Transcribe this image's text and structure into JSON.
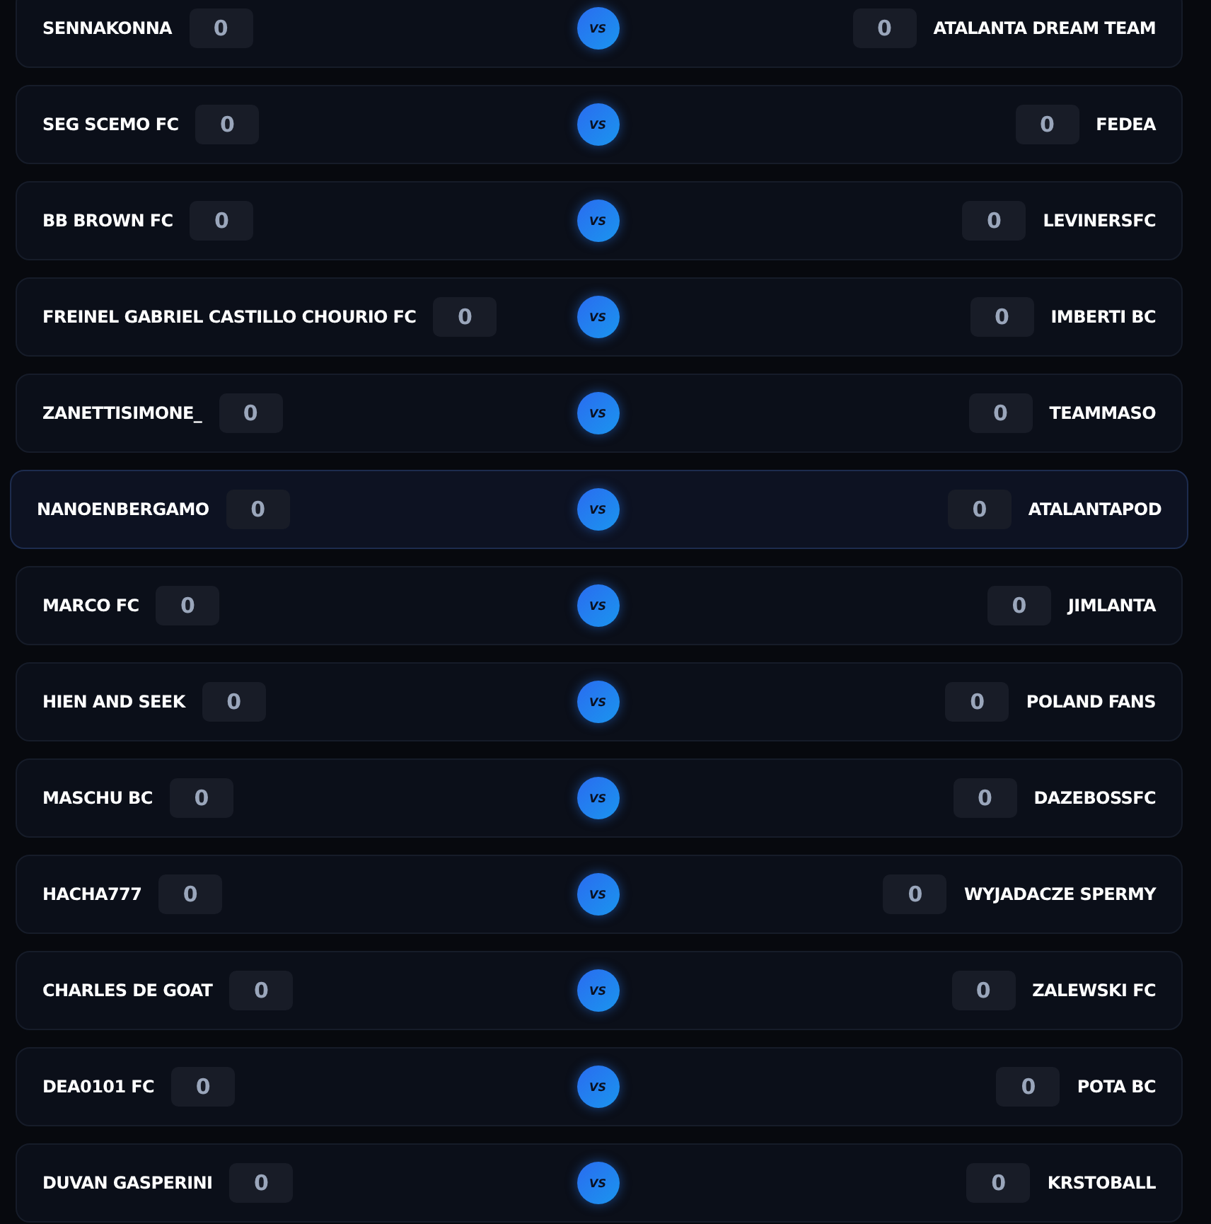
{
  "matches": [
    {
      "home": {
        "name": "SENNAKONNA",
        "score": "0"
      },
      "vs_label": "VS",
      "away": {
        "name": "ATALANTA DREAM TEAM",
        "score": "0"
      },
      "highlighted": false
    },
    {
      "home": {
        "name": "SEG SCEMO FC",
        "score": "0"
      },
      "vs_label": "VS",
      "away": {
        "name": "FEDEA",
        "score": "0"
      },
      "highlighted": false
    },
    {
      "home": {
        "name": "BB BROWN FC",
        "score": "0"
      },
      "vs_label": "VS",
      "away": {
        "name": "LEVINERSFC",
        "score": "0"
      },
      "highlighted": false
    },
    {
      "home": {
        "name": "FREINEL GABRIEL CASTILLO CHOURIO FC",
        "score": "0"
      },
      "vs_label": "VS",
      "away": {
        "name": "IMBERTI BC",
        "score": "0"
      },
      "highlighted": false
    },
    {
      "home": {
        "name": "ZANETTISIMONE_",
        "score": "0"
      },
      "vs_label": "VS",
      "away": {
        "name": "TEAMMASO",
        "score": "0"
      },
      "highlighted": false
    },
    {
      "home": {
        "name": "NANOENBERGAMO",
        "score": "0"
      },
      "vs_label": "VS",
      "away": {
        "name": "ATALANTAPOD",
        "score": "0"
      },
      "highlighted": true
    },
    {
      "home": {
        "name": "MARCO FC",
        "score": "0"
      },
      "vs_label": "VS",
      "away": {
        "name": "JIMLANTA",
        "score": "0"
      },
      "highlighted": false
    },
    {
      "home": {
        "name": "HIEN AND SEEK",
        "score": "0"
      },
      "vs_label": "VS",
      "away": {
        "name": "POLAND FANS",
        "score": "0"
      },
      "highlighted": false
    },
    {
      "home": {
        "name": "MASCHU BC",
        "score": "0"
      },
      "vs_label": "VS",
      "away": {
        "name": "DAZEBOSSFC",
        "score": "0"
      },
      "highlighted": false
    },
    {
      "home": {
        "name": "HACHA777",
        "score": "0"
      },
      "vs_label": "VS",
      "away": {
        "name": "WYJADACZE SPERMY",
        "score": "0"
      },
      "highlighted": false
    },
    {
      "home": {
        "name": "CHARLES DE GOAT",
        "score": "0"
      },
      "vs_label": "VS",
      "away": {
        "name": "ZALEWSKI FC",
        "score": "0"
      },
      "highlighted": false
    },
    {
      "home": {
        "name": "DEA0101 FC",
        "score": "0"
      },
      "vs_label": "VS",
      "away": {
        "name": "POTA BC",
        "score": "0"
      },
      "highlighted": false
    },
    {
      "home": {
        "name": "DUVAN GASPERINI",
        "score": "0"
      },
      "vs_label": "VS",
      "away": {
        "name": "KRSTOBALL",
        "score": "0"
      },
      "highlighted": false
    }
  ]
}
